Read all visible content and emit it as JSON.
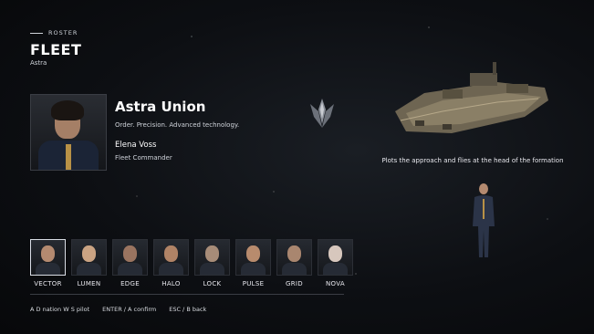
{
  "header": {
    "tag": "ROSTER",
    "title": "FLEET",
    "subtitle": "Astra"
  },
  "faction": {
    "name": "Astra Union",
    "motto": "Order. Precision. Advanced technology.",
    "leader_name": "Elena Voss",
    "leader_role": "Fleet Commander"
  },
  "ship": {
    "description": "Plots the approach and flies at the head of the formation"
  },
  "roster": {
    "pilots": [
      {
        "label": "VECTOR",
        "selected": true,
        "skin": "#b48a70"
      },
      {
        "label": "LUMEN",
        "selected": false,
        "skin": "#caa383"
      },
      {
        "label": "EDGE",
        "selected": false,
        "skin": "#9a7460"
      },
      {
        "label": "HALO",
        "selected": false,
        "skin": "#b08366"
      },
      {
        "label": "LOCK",
        "selected": false,
        "skin": "#a78c78"
      },
      {
        "label": "PULSE",
        "selected": false,
        "skin": "#b88b6d"
      },
      {
        "label": "GRID",
        "selected": false,
        "skin": "#a9866f"
      },
      {
        "label": "NOVA",
        "selected": false,
        "skin": "#d7c7bd"
      }
    ]
  },
  "hints": {
    "navigation": "A D nation  W S pilot",
    "confirm": "ENTER / A confirm",
    "back": "ESC / B back"
  },
  "colors": {
    "accent": "#b89146",
    "text": "#e8e8ee",
    "background": "#0d0f13"
  }
}
